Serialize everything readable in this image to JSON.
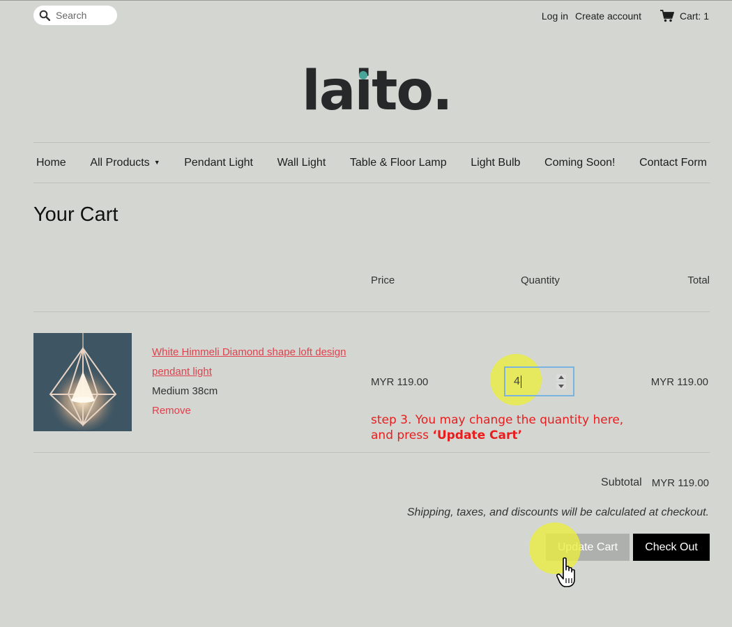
{
  "header": {
    "search_placeholder": "Search",
    "login": "Log in",
    "create_account": "Create account",
    "cart": "Cart: 1"
  },
  "logo": {
    "text": "laito.",
    "accent_color": "#49a59a"
  },
  "nav": {
    "items": [
      {
        "label": "Home"
      },
      {
        "label": "All Products"
      },
      {
        "label": "Pendant Light"
      },
      {
        "label": "Wall Light"
      },
      {
        "label": "Table & Floor Lamp"
      },
      {
        "label": "Light Bulb"
      },
      {
        "label": "Coming Soon!"
      },
      {
        "label": "Contact Form"
      }
    ]
  },
  "page": {
    "title": "Your Cart"
  },
  "cart": {
    "columns": {
      "price": "Price",
      "quantity": "Quantity",
      "total": "Total"
    },
    "items": [
      {
        "title": "White Himmeli Diamond shape loft design pendant light",
        "variant": "Medium 38cm",
        "remove": "Remove",
        "price": "MYR 119.00",
        "quantity": "4",
        "total": "MYR 119.00"
      }
    ],
    "subtotal_label": "Subtotal",
    "subtotal_value": "MYR 119.00",
    "shipping_note": "Shipping, taxes, and discounts will be calculated at checkout.",
    "update_button": "Update Cart",
    "checkout_button": "Check Out"
  },
  "annotation": {
    "line1": "step 3. You may change the quantity here,",
    "line2_prefix": "and press ",
    "line2_emphasis": "‘Update Cart’"
  },
  "colors": {
    "background": "#d3d6d1",
    "product_link": "#e1404c",
    "annotation": "#e81d1d",
    "highlight": "#ecee3c"
  }
}
